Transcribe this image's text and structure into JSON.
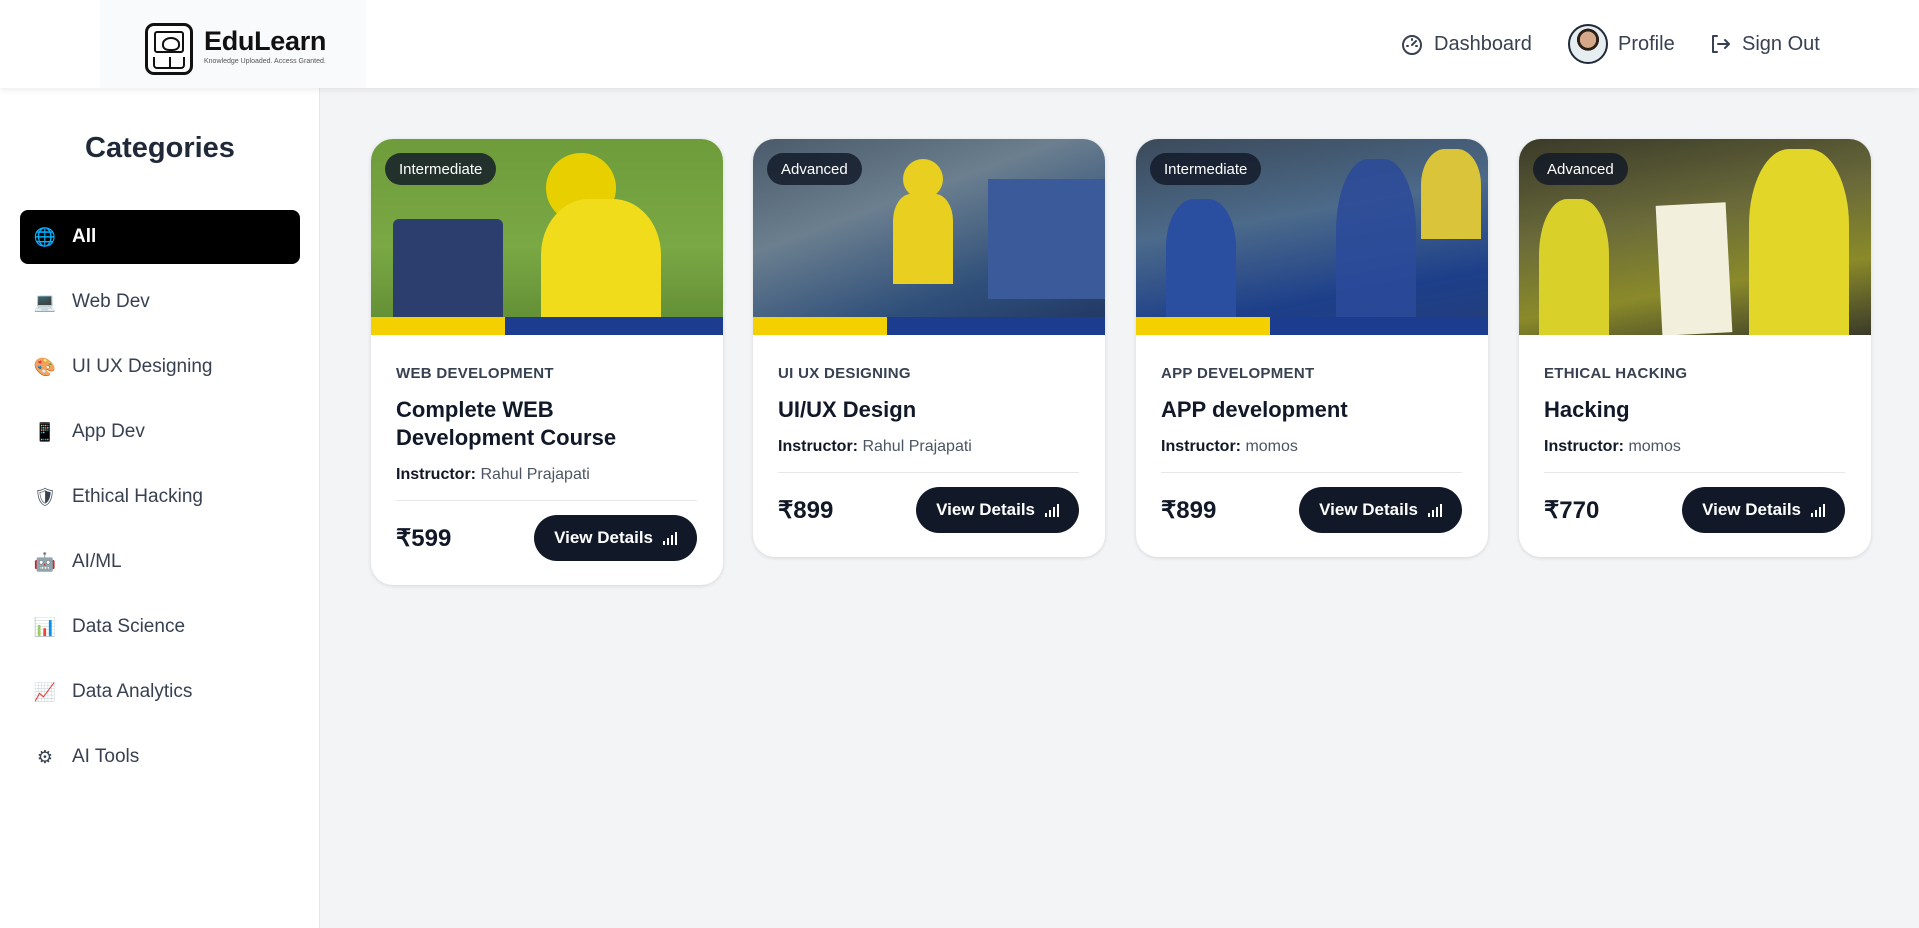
{
  "brand": {
    "name": "EduLearn",
    "tagline": "Knowledge Uploaded. Access Granted."
  },
  "nav": {
    "dashboard": "Dashboard",
    "profile": "Profile",
    "signout": "Sign Out"
  },
  "sidebar": {
    "title": "Categories",
    "items": [
      {
        "label": "All",
        "icon": "globe-icon",
        "glyph": "🌐",
        "active": true
      },
      {
        "label": "Web Dev",
        "icon": "laptop-icon",
        "glyph": "💻"
      },
      {
        "label": "UI UX Designing",
        "icon": "palette-icon",
        "glyph": "🎨"
      },
      {
        "label": "App Dev",
        "icon": "mobile-icon",
        "glyph": "📱"
      },
      {
        "label": "Ethical Hacking",
        "icon": "shield-icon",
        "glyph": "🛡"
      },
      {
        "label": "AI/ML",
        "icon": "robot-icon",
        "glyph": "🤖"
      },
      {
        "label": "Data Science",
        "icon": "bar-chart-icon",
        "glyph": "📊"
      },
      {
        "label": "Data Analytics",
        "icon": "line-chart-icon",
        "glyph": "📈"
      },
      {
        "label": "AI Tools",
        "icon": "gear-icon",
        "glyph": "⚙"
      }
    ]
  },
  "courses": [
    {
      "level": "Intermediate",
      "category": "WEB DEVELOPMENT",
      "title": "Complete WEB Development Course",
      "instructor_label": "Instructor:",
      "instructor": "Rahul Prajapati",
      "price": "₹599",
      "button": "View Details"
    },
    {
      "level": "Advanced",
      "category": "UI UX DESIGNING",
      "title": "UI/UX Design",
      "instructor_label": "Instructor:",
      "instructor": "Rahul Prajapati",
      "price": "₹899",
      "button": "View Details"
    },
    {
      "level": "Intermediate",
      "category": "APP DEVELOPMENT",
      "title": "APP development",
      "instructor_label": "Instructor:",
      "instructor": "momos",
      "price": "₹899",
      "button": "View Details"
    },
    {
      "level": "Advanced",
      "category": "ETHICAL HACKING",
      "title": "Hacking",
      "instructor_label": "Instructor:",
      "instructor": "momos",
      "price": "₹770",
      "button": "View Details"
    }
  ],
  "colors": {
    "accent": "#111827",
    "active_category": "#000000",
    "page_bg": "#f3f4f6"
  }
}
